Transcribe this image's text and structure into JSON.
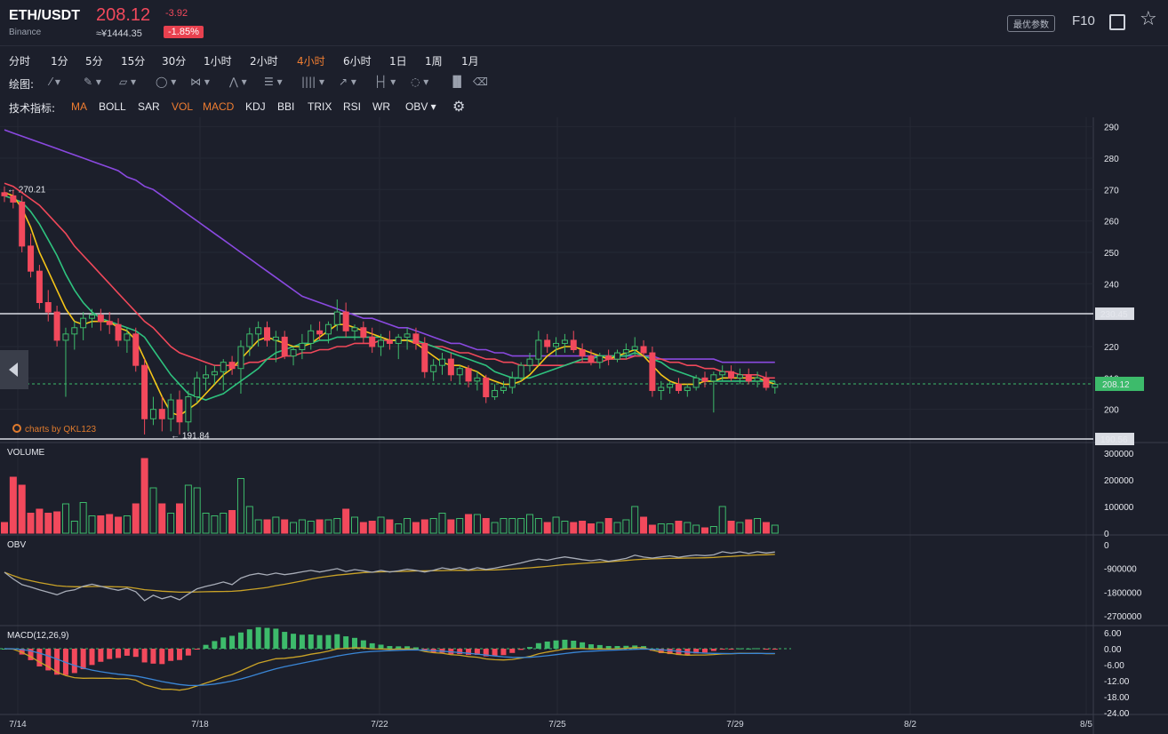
{
  "header": {
    "pair": "ETH/USDT",
    "exchange": "Binance",
    "price": "208.12",
    "change": "-3.92",
    "cny": "≈¥1444.35",
    "change_pct": "-1.85%",
    "best_params": "最优参数",
    "f10": "F10"
  },
  "periods": [
    {
      "label": "分时",
      "active": false
    },
    {
      "label": "1分",
      "active": false
    },
    {
      "label": "5分",
      "active": false
    },
    {
      "label": "15分",
      "active": false
    },
    {
      "label": "30分",
      "active": false
    },
    {
      "label": "1小时",
      "active": false
    },
    {
      "label": "2小时",
      "active": false
    },
    {
      "label": "4小时",
      "active": true
    },
    {
      "label": "6小时",
      "active": false
    },
    {
      "label": "1日",
      "active": false
    },
    {
      "label": "1周",
      "active": false
    },
    {
      "label": "1月",
      "active": false
    }
  ],
  "draw": {
    "label": "绘图:",
    "tools": [
      "line-tool-icon",
      "pen-tool-icon",
      "channel-tool-icon",
      "ellipse-tool-icon",
      "fib-tool-icon",
      "pattern-tool-icon",
      "levels-tool-icon",
      "bars-tool-icon",
      "arrow-tool-icon",
      "range-tool-icon",
      "comment-tool-icon",
      "chart-type-icon",
      "delete-icon"
    ]
  },
  "indicators": {
    "label": "技术指标:",
    "items": [
      {
        "label": "MA",
        "on": true
      },
      {
        "label": "BOLL",
        "on": false
      },
      {
        "label": "SAR",
        "on": false
      },
      {
        "label": "VOL",
        "on": true
      },
      {
        "label": "MACD",
        "on": true
      },
      {
        "label": "KDJ",
        "on": false
      },
      {
        "label": "BBI",
        "on": false
      },
      {
        "label": "TRIX",
        "on": false
      },
      {
        "label": "RSI",
        "on": false
      },
      {
        "label": "WR",
        "on": false
      },
      {
        "label": "OBV ▾",
        "on": false
      }
    ]
  },
  "credit": "charts by QKL123",
  "chart_data": {
    "type": "candlestick",
    "x_labels": [
      "7/14",
      "7/18",
      "7/22",
      "7/25",
      "7/29",
      "8/2",
      "8/5"
    ],
    "price_axis": {
      "ticks": [
        290,
        280,
        270,
        260,
        250,
        240,
        230,
        220,
        210,
        200
      ],
      "ylim": [
        190,
        293
      ]
    },
    "levels": {
      "high_mark": "270.21",
      "low_mark": "191.84",
      "line_top": "230.45",
      "line_bottom": "190.56",
      "current": "208.12"
    },
    "candles": [
      {
        "o": 269,
        "h": 271,
        "l": 266,
        "c": 268
      },
      {
        "o": 268,
        "h": 270,
        "l": 264,
        "c": 266
      },
      {
        "o": 266,
        "h": 268,
        "l": 250,
        "c": 252
      },
      {
        "o": 252,
        "h": 256,
        "l": 242,
        "c": 244
      },
      {
        "o": 244,
        "h": 246,
        "l": 232,
        "c": 234
      },
      {
        "o": 234,
        "h": 238,
        "l": 228,
        "c": 231
      },
      {
        "o": 231,
        "h": 233,
        "l": 220,
        "c": 222
      },
      {
        "o": 222,
        "h": 226,
        "l": 204,
        "c": 224
      },
      {
        "o": 224,
        "h": 228,
        "l": 219,
        "c": 226
      },
      {
        "o": 226,
        "h": 231,
        "l": 222,
        "c": 229
      },
      {
        "o": 229,
        "h": 232,
        "l": 226,
        "c": 230
      },
      {
        "o": 230,
        "h": 232,
        "l": 225,
        "c": 228
      },
      {
        "o": 228,
        "h": 231,
        "l": 224,
        "c": 227
      },
      {
        "o": 227,
        "h": 229,
        "l": 220,
        "c": 222
      },
      {
        "o": 222,
        "h": 226,
        "l": 218,
        "c": 224
      },
      {
        "o": 224,
        "h": 226,
        "l": 212,
        "c": 214
      },
      {
        "o": 214,
        "h": 216,
        "l": 192,
        "c": 197
      },
      {
        "o": 197,
        "h": 204,
        "l": 195,
        "c": 200
      },
      {
        "o": 200,
        "h": 204,
        "l": 193,
        "c": 197
      },
      {
        "o": 197,
        "h": 205,
        "l": 193,
        "c": 203
      },
      {
        "o": 203,
        "h": 206,
        "l": 192,
        "c": 196
      },
      {
        "o": 196,
        "h": 206,
        "l": 193,
        "c": 204
      },
      {
        "o": 204,
        "h": 212,
        "l": 202,
        "c": 210
      },
      {
        "o": 210,
        "h": 214,
        "l": 206,
        "c": 211
      },
      {
        "o": 211,
        "h": 214,
        "l": 208,
        "c": 212
      },
      {
        "o": 212,
        "h": 216,
        "l": 206,
        "c": 215
      },
      {
        "o": 215,
        "h": 217,
        "l": 211,
        "c": 213
      },
      {
        "o": 213,
        "h": 222,
        "l": 205,
        "c": 220
      },
      {
        "o": 220,
        "h": 226,
        "l": 217,
        "c": 224
      },
      {
        "o": 224,
        "h": 228,
        "l": 220,
        "c": 226
      },
      {
        "o": 226,
        "h": 228,
        "l": 220,
        "c": 222
      },
      {
        "o": 222,
        "h": 225,
        "l": 215,
        "c": 223
      },
      {
        "o": 223,
        "h": 225,
        "l": 216,
        "c": 217
      },
      {
        "o": 217,
        "h": 220,
        "l": 214,
        "c": 219
      },
      {
        "o": 219,
        "h": 224,
        "l": 216,
        "c": 221
      },
      {
        "o": 221,
        "h": 227,
        "l": 219,
        "c": 225
      },
      {
        "o": 225,
        "h": 228,
        "l": 222,
        "c": 224
      },
      {
        "o": 224,
        "h": 228,
        "l": 221,
        "c": 227
      },
      {
        "o": 227,
        "h": 235,
        "l": 225,
        "c": 231
      },
      {
        "o": 231,
        "h": 234,
        "l": 223,
        "c": 225
      },
      {
        "o": 225,
        "h": 227,
        "l": 222,
        "c": 226
      },
      {
        "o": 226,
        "h": 228,
        "l": 221,
        "c": 223
      },
      {
        "o": 223,
        "h": 226,
        "l": 218,
        "c": 220
      },
      {
        "o": 220,
        "h": 224,
        "l": 217,
        "c": 222
      },
      {
        "o": 222,
        "h": 225,
        "l": 219,
        "c": 221
      },
      {
        "o": 221,
        "h": 224,
        "l": 216,
        "c": 223
      },
      {
        "o": 223,
        "h": 226,
        "l": 219,
        "c": 224
      },
      {
        "o": 224,
        "h": 226,
        "l": 219,
        "c": 221
      },
      {
        "o": 221,
        "h": 223,
        "l": 210,
        "c": 212
      },
      {
        "o": 212,
        "h": 216,
        "l": 209,
        "c": 214
      },
      {
        "o": 214,
        "h": 218,
        "l": 211,
        "c": 216
      },
      {
        "o": 216,
        "h": 218,
        "l": 209,
        "c": 211
      },
      {
        "o": 211,
        "h": 214,
        "l": 208,
        "c": 213
      },
      {
        "o": 213,
        "h": 214,
        "l": 207,
        "c": 209
      },
      {
        "o": 209,
        "h": 212,
        "l": 206,
        "c": 210
      },
      {
        "o": 210,
        "h": 211,
        "l": 202,
        "c": 204
      },
      {
        "o": 204,
        "h": 208,
        "l": 203,
        "c": 206
      },
      {
        "o": 206,
        "h": 209,
        "l": 205,
        "c": 207
      },
      {
        "o": 207,
        "h": 212,
        "l": 205,
        "c": 210
      },
      {
        "o": 210,
        "h": 215,
        "l": 209,
        "c": 214
      },
      {
        "o": 214,
        "h": 218,
        "l": 212,
        "c": 216
      },
      {
        "o": 216,
        "h": 225,
        "l": 214,
        "c": 222
      },
      {
        "o": 222,
        "h": 224,
        "l": 218,
        "c": 220
      },
      {
        "o": 220,
        "h": 223,
        "l": 217,
        "c": 221
      },
      {
        "o": 221,
        "h": 224,
        "l": 218,
        "c": 222
      },
      {
        "o": 222,
        "h": 225,
        "l": 218,
        "c": 219
      },
      {
        "o": 219,
        "h": 221,
        "l": 215,
        "c": 217
      },
      {
        "o": 217,
        "h": 219,
        "l": 214,
        "c": 215
      },
      {
        "o": 215,
        "h": 218,
        "l": 213,
        "c": 217
      },
      {
        "o": 217,
        "h": 219,
        "l": 214,
        "c": 216
      },
      {
        "o": 216,
        "h": 219,
        "l": 215,
        "c": 218
      },
      {
        "o": 218,
        "h": 221,
        "l": 216,
        "c": 219
      },
      {
        "o": 219,
        "h": 223,
        "l": 217,
        "c": 220
      },
      {
        "o": 220,
        "h": 222,
        "l": 217,
        "c": 218
      },
      {
        "o": 218,
        "h": 220,
        "l": 204,
        "c": 206
      },
      {
        "o": 206,
        "h": 209,
        "l": 203,
        "c": 207
      },
      {
        "o": 207,
        "h": 209,
        "l": 205,
        "c": 208
      },
      {
        "o": 208,
        "h": 210,
        "l": 205,
        "c": 206
      },
      {
        "o": 206,
        "h": 208,
        "l": 204,
        "c": 207
      },
      {
        "o": 207,
        "h": 211,
        "l": 206,
        "c": 210
      },
      {
        "o": 210,
        "h": 212,
        "l": 207,
        "c": 209
      },
      {
        "o": 209,
        "h": 212,
        "l": 199,
        "c": 211
      },
      {
        "o": 211,
        "h": 214,
        "l": 209,
        "c": 212
      },
      {
        "o": 212,
        "h": 214,
        "l": 209,
        "c": 210
      },
      {
        "o": 210,
        "h": 213,
        "l": 208,
        "c": 211
      },
      {
        "o": 211,
        "h": 213,
        "l": 208,
        "c": 209
      },
      {
        "o": 209,
        "h": 212,
        "l": 207,
        "c": 210
      },
      {
        "o": 210,
        "h": 212,
        "l": 206,
        "c": 207
      },
      {
        "o": 207,
        "h": 209,
        "l": 205,
        "c": 208
      }
    ],
    "ma5": [
      269,
      268,
      264,
      258,
      250,
      244,
      238,
      232,
      228,
      227,
      228,
      228,
      228,
      226,
      225,
      222,
      216,
      210,
      204,
      199,
      198,
      200,
      202,
      205,
      208,
      211,
      213,
      216,
      219,
      222,
      223,
      222,
      221,
      220,
      220,
      221,
      223,
      225,
      227,
      227,
      226,
      225,
      224,
      223,
      222,
      222,
      222,
      221,
      219,
      217,
      215,
      214,
      214,
      213,
      212,
      210,
      209,
      208,
      208,
      209,
      211,
      214,
      217,
      219,
      220,
      220,
      219,
      218,
      217,
      216,
      217,
      218,
      219,
      217,
      214,
      211,
      209,
      208,
      208,
      208,
      209,
      209,
      210,
      210,
      210,
      210,
      210,
      209,
      208
    ],
    "ma10": [
      268,
      267,
      266,
      263,
      259,
      254,
      249,
      243,
      238,
      234,
      231,
      229,
      228,
      227,
      226,
      225,
      223,
      219,
      215,
      211,
      208,
      205,
      204,
      203,
      204,
      205,
      207,
      209,
      211,
      213,
      216,
      218,
      219,
      220,
      221,
      221,
      222,
      222,
      223,
      223,
      223,
      223,
      223,
      223,
      222,
      222,
      222,
      222,
      221,
      220,
      219,
      218,
      217,
      216,
      215,
      214,
      212,
      211,
      210,
      210,
      210,
      211,
      212,
      213,
      214,
      215,
      216,
      216,
      217,
      217,
      217,
      217,
      218,
      217,
      216,
      215,
      213,
      212,
      211,
      210,
      209,
      209,
      209,
      209,
      209,
      209,
      209,
      209,
      209
    ],
    "ma20": [
      272,
      271,
      269,
      267,
      265,
      262,
      259,
      256,
      252,
      249,
      246,
      243,
      240,
      237,
      234,
      231,
      228,
      226,
      223,
      220,
      218,
      217,
      216,
      215,
      214,
      214,
      214,
      214,
      215,
      215,
      216,
      216,
      217,
      217,
      218,
      218,
      219,
      219,
      220,
      220,
      221,
      221,
      221,
      222,
      222,
      222,
      222,
      221,
      221,
      220,
      220,
      219,
      218,
      218,
      217,
      216,
      216,
      215,
      215,
      214,
      214,
      214,
      214,
      214,
      214,
      215,
      215,
      215,
      215,
      216,
      216,
      216,
      217,
      217,
      216,
      216,
      215,
      215,
      214,
      214,
      213,
      213,
      212,
      212,
      211,
      211,
      211,
      210,
      210
    ],
    "ma60": [
      289,
      288,
      287,
      286,
      285,
      284,
      283,
      282,
      281,
      280,
      279,
      278,
      277,
      276,
      274,
      273,
      271,
      270,
      268,
      266,
      264,
      262,
      260,
      258,
      256,
      254,
      252,
      250,
      248,
      246,
      244,
      242,
      240,
      238,
      236,
      235,
      234,
      233,
      232,
      231,
      230,
      229,
      229,
      228,
      227,
      226,
      226,
      225,
      224,
      223,
      222,
      221,
      221,
      220,
      219,
      219,
      218,
      218,
      217,
      217,
      217,
      217,
      217,
      217,
      217,
      217,
      217,
      217,
      217,
      217,
      217,
      217,
      217,
      217,
      217,
      216,
      216,
      216,
      216,
      216,
      216,
      216,
      215,
      215,
      215,
      215,
      215,
      215,
      215
    ],
    "volume": {
      "ticks": [
        "300000",
        "200000",
        "100000",
        "0"
      ],
      "max": 300000,
      "values": [
        40000,
        210000,
        180000,
        75000,
        90000,
        75000,
        80000,
        110000,
        45000,
        115000,
        65000,
        65000,
        70000,
        60000,
        65000,
        110000,
        280000,
        170000,
        110000,
        75000,
        110000,
        180000,
        170000,
        75000,
        65000,
        75000,
        85000,
        205000,
        100000,
        50000,
        50000,
        60000,
        50000,
        40000,
        50000,
        45000,
        50000,
        50000,
        55000,
        90000,
        60000,
        40000,
        45000,
        60000,
        50000,
        35000,
        55000,
        40000,
        50000,
        55000,
        75000,
        50000,
        55000,
        70000,
        70000,
        55000,
        40000,
        55000,
        55000,
        55000,
        70000,
        55000,
        40000,
        60000,
        45000,
        40000,
        45000,
        35000,
        40000,
        55000,
        40000,
        50000,
        100000,
        60000,
        30000,
        35000,
        35000,
        45000,
        40000,
        30000,
        20000,
        25000,
        100000,
        45000,
        40000,
        50000,
        55000,
        40000,
        30000
      ]
    },
    "obv": {
      "ticks": [
        "0",
        "-900000",
        "-1800000",
        "-2700000"
      ],
      "ylim": [
        -3000000,
        300000
      ]
    },
    "macd": {
      "label": "MACD(12,26,9)",
      "ticks": [
        "6.00",
        "0.00",
        "-6.00",
        "-12.00",
        "-18.00",
        "-24.00"
      ],
      "ylim": [
        -24,
        6
      ]
    }
  }
}
